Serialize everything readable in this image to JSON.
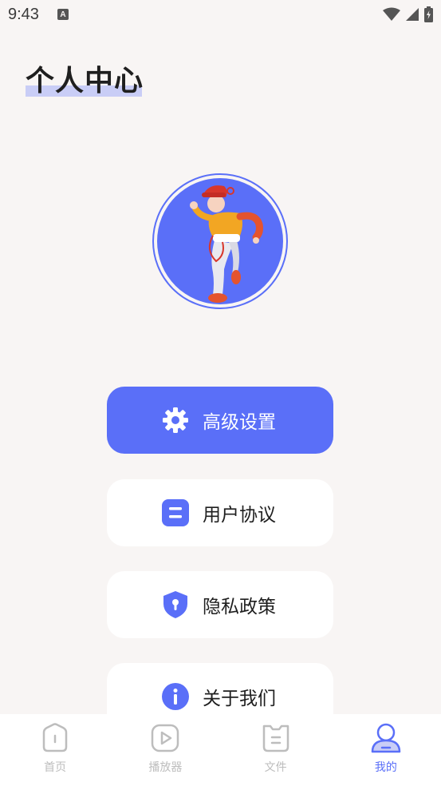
{
  "status_bar": {
    "time": "9:43",
    "notification_letter": "A"
  },
  "page": {
    "title": "个人中心"
  },
  "menu": [
    {
      "label": "高级设置",
      "icon": "gear-icon"
    },
    {
      "label": "用户协议",
      "icon": "document-icon"
    },
    {
      "label": "隐私政策",
      "icon": "shield-icon"
    },
    {
      "label": "关于我们",
      "icon": "info-icon"
    }
  ],
  "tabs": [
    {
      "label": "首页",
      "icon": "home-icon",
      "active": false
    },
    {
      "label": "播放器",
      "icon": "play-icon",
      "active": false
    },
    {
      "label": "文件",
      "icon": "file-icon",
      "active": false
    },
    {
      "label": "我的",
      "icon": "user-icon",
      "active": true
    }
  ],
  "colors": {
    "accent": "#5a6ff8",
    "background": "#f8f5f4",
    "inactive": "#bdbdbd"
  }
}
